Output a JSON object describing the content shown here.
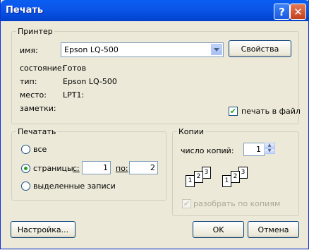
{
  "window": {
    "title": "Печать",
    "help_glyph": "?",
    "close_glyph": "✕"
  },
  "printer_group": {
    "title": "Принтер",
    "name_label": "имя:",
    "name_value": "Epson LQ-500",
    "properties_button": "Свойства",
    "status_label": "состояние:",
    "status_value": "Готов",
    "type_label": "тип:",
    "type_value": "Epson LQ-500",
    "location_label": "место:",
    "location_value": "LPT1:",
    "comment_label": "заметки:",
    "print_to_file_label": "печать в файл",
    "print_to_file_checked": true
  },
  "print_range_group": {
    "title": "Печатать",
    "all_label": "все",
    "pages_label": "страницы",
    "from_label": "с:",
    "from_value": "1",
    "to_label": "по:",
    "to_value": "2",
    "selection_label": "выделенные записи",
    "selected": "pages"
  },
  "copies_group": {
    "title": "Копии",
    "count_label": "число копий:",
    "count_value": "1",
    "collate_label": "разобрать по копиям",
    "collate_checked": true,
    "collate_enabled": false,
    "page_numbers": [
      "1",
      "2",
      "3"
    ]
  },
  "buttons": {
    "setup": "Настройка...",
    "ok": "OK",
    "cancel": "Отмена"
  }
}
